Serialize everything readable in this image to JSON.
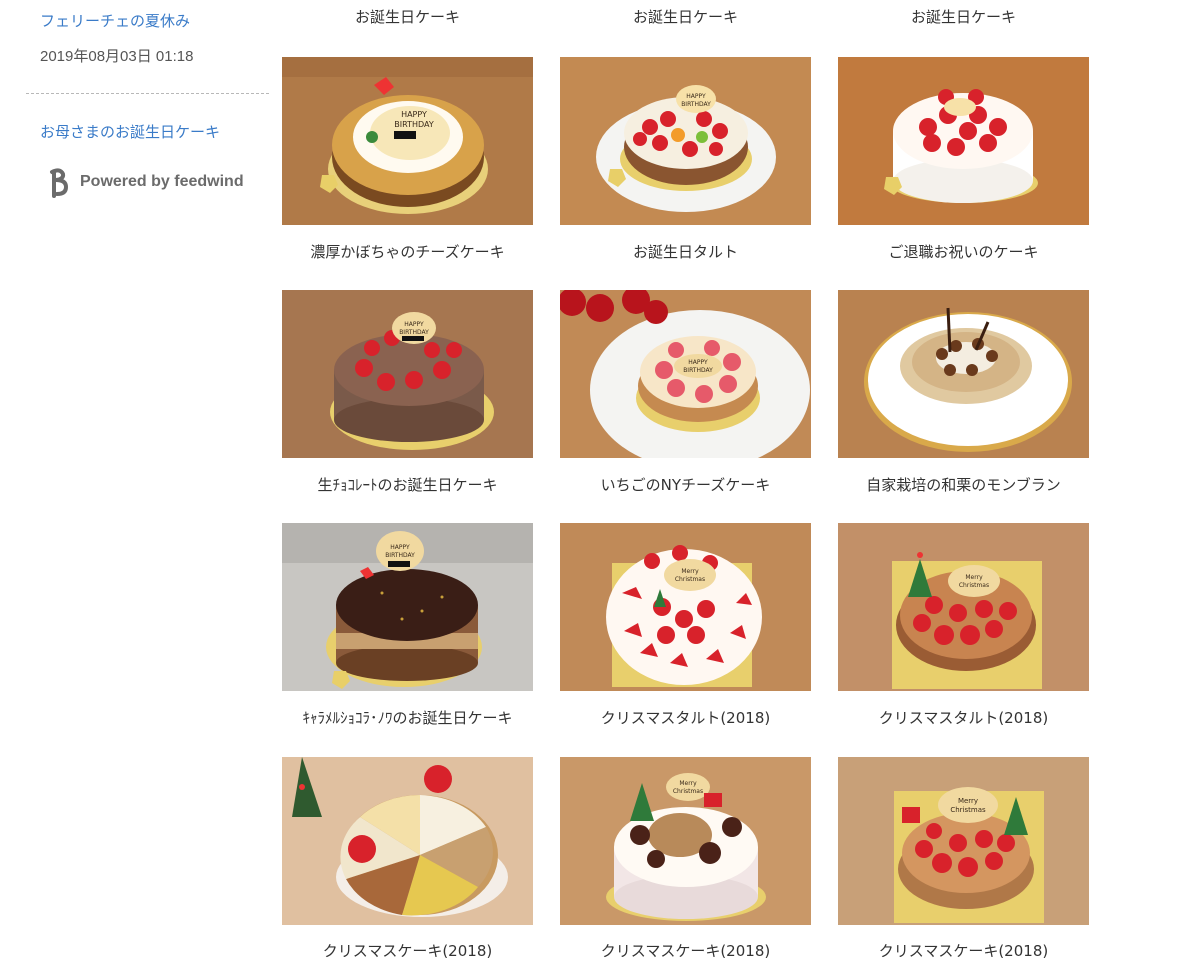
{
  "sidebar": {
    "post1_title": "フェリーチェの夏休み",
    "post1_date": "2019年08月03日 01:18",
    "post2_title": "お母さまのお誕生日ケーキ",
    "powered_by": "Powered by feedwind"
  },
  "top_row_labels": [
    "お誕生日ケーキ",
    "お誕生日ケーキ",
    "お誕生日ケーキ"
  ],
  "cakes": [
    {
      "title": "濃厚かぼちゃのチーズケーキ",
      "photo": "pumpkin-cheesecake-photo"
    },
    {
      "title": "お誕生日タルト",
      "photo": "birthday-fruit-tart-photo"
    },
    {
      "title": "ご退職お祝いのケーキ",
      "photo": "retirement-strawberry-cake-photo"
    },
    {
      "title": "生ﾁｮｺﾚｰﾄのお誕生日ケーキ",
      "photo": "chocolate-birthday-cake-photo"
    },
    {
      "title": "いちごのNYチーズケーキ",
      "photo": "strawberry-ny-cheesecake-photo"
    },
    {
      "title": "自家栽培の和栗のモンブラン",
      "photo": "chestnut-mont-blanc-photo"
    },
    {
      "title": "ｷｬﾗﾒﾙｼｮｺﾗ･ﾉﾜのお誕生日ケーキ",
      "photo": "caramel-chocolate-cake-photo"
    },
    {
      "title": "クリスマスタルト(2018)",
      "photo": "christmas-tart-photo-1"
    },
    {
      "title": "クリスマスタルト(2018)",
      "photo": "christmas-tart-photo-2"
    },
    {
      "title": "クリスマスケーキ(2018)",
      "photo": "christmas-slice-cake-photo"
    },
    {
      "title": "クリスマスケーキ(2018)",
      "photo": "christmas-chestnut-cake-photo"
    },
    {
      "title": "クリスマスケーキ(2018)",
      "photo": "christmas-strawberry-cake-photo"
    }
  ],
  "photo_text": {
    "happy_birthday": "HAPPY BIRTHDAY",
    "merry_christmas": "Merry Christmas"
  },
  "colors": {
    "link": "#3a7bc8",
    "wood": "#c98b55",
    "cream": "#fff6ee",
    "strawberry": "#d8222b",
    "chocolate": "#4a2a1c",
    "gold": "#e9c85b",
    "board_gold": "#e8d07a"
  }
}
